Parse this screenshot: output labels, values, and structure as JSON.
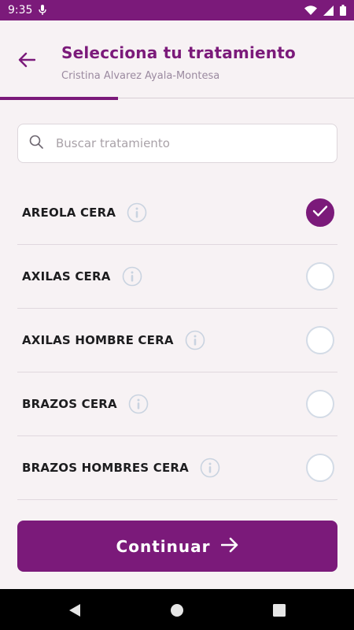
{
  "status_bar": {
    "time": "9:35"
  },
  "header": {
    "title": "Selecciona tu tratamiento",
    "subtitle": "Cristina Alvarez Ayala-Montesa",
    "progress": 0.333
  },
  "search": {
    "placeholder": "Buscar tratamiento",
    "value": ""
  },
  "treatments": [
    {
      "label": "AREOLA CERA",
      "selected": true
    },
    {
      "label": "AXILAS CERA",
      "selected": false
    },
    {
      "label": "AXILAS HOMBRE CERA",
      "selected": false
    },
    {
      "label": "BRAZOS CERA",
      "selected": false
    },
    {
      "label": "BRAZOS HOMBRES CERA",
      "selected": false
    }
  ],
  "continue_button": {
    "label": "Continuar"
  },
  "colors": {
    "brand": "#7b1a7a",
    "background": "#f7f2f4",
    "check_border": "#d3dbe6"
  },
  "icons": [
    "mic-icon",
    "wifi-icon",
    "cellular-icon",
    "battery-icon",
    "arrow-left-icon",
    "search-icon",
    "info-icon",
    "checkmark-icon",
    "arrow-right-icon",
    "nav-back-icon",
    "nav-home-icon",
    "nav-recents-icon"
  ]
}
